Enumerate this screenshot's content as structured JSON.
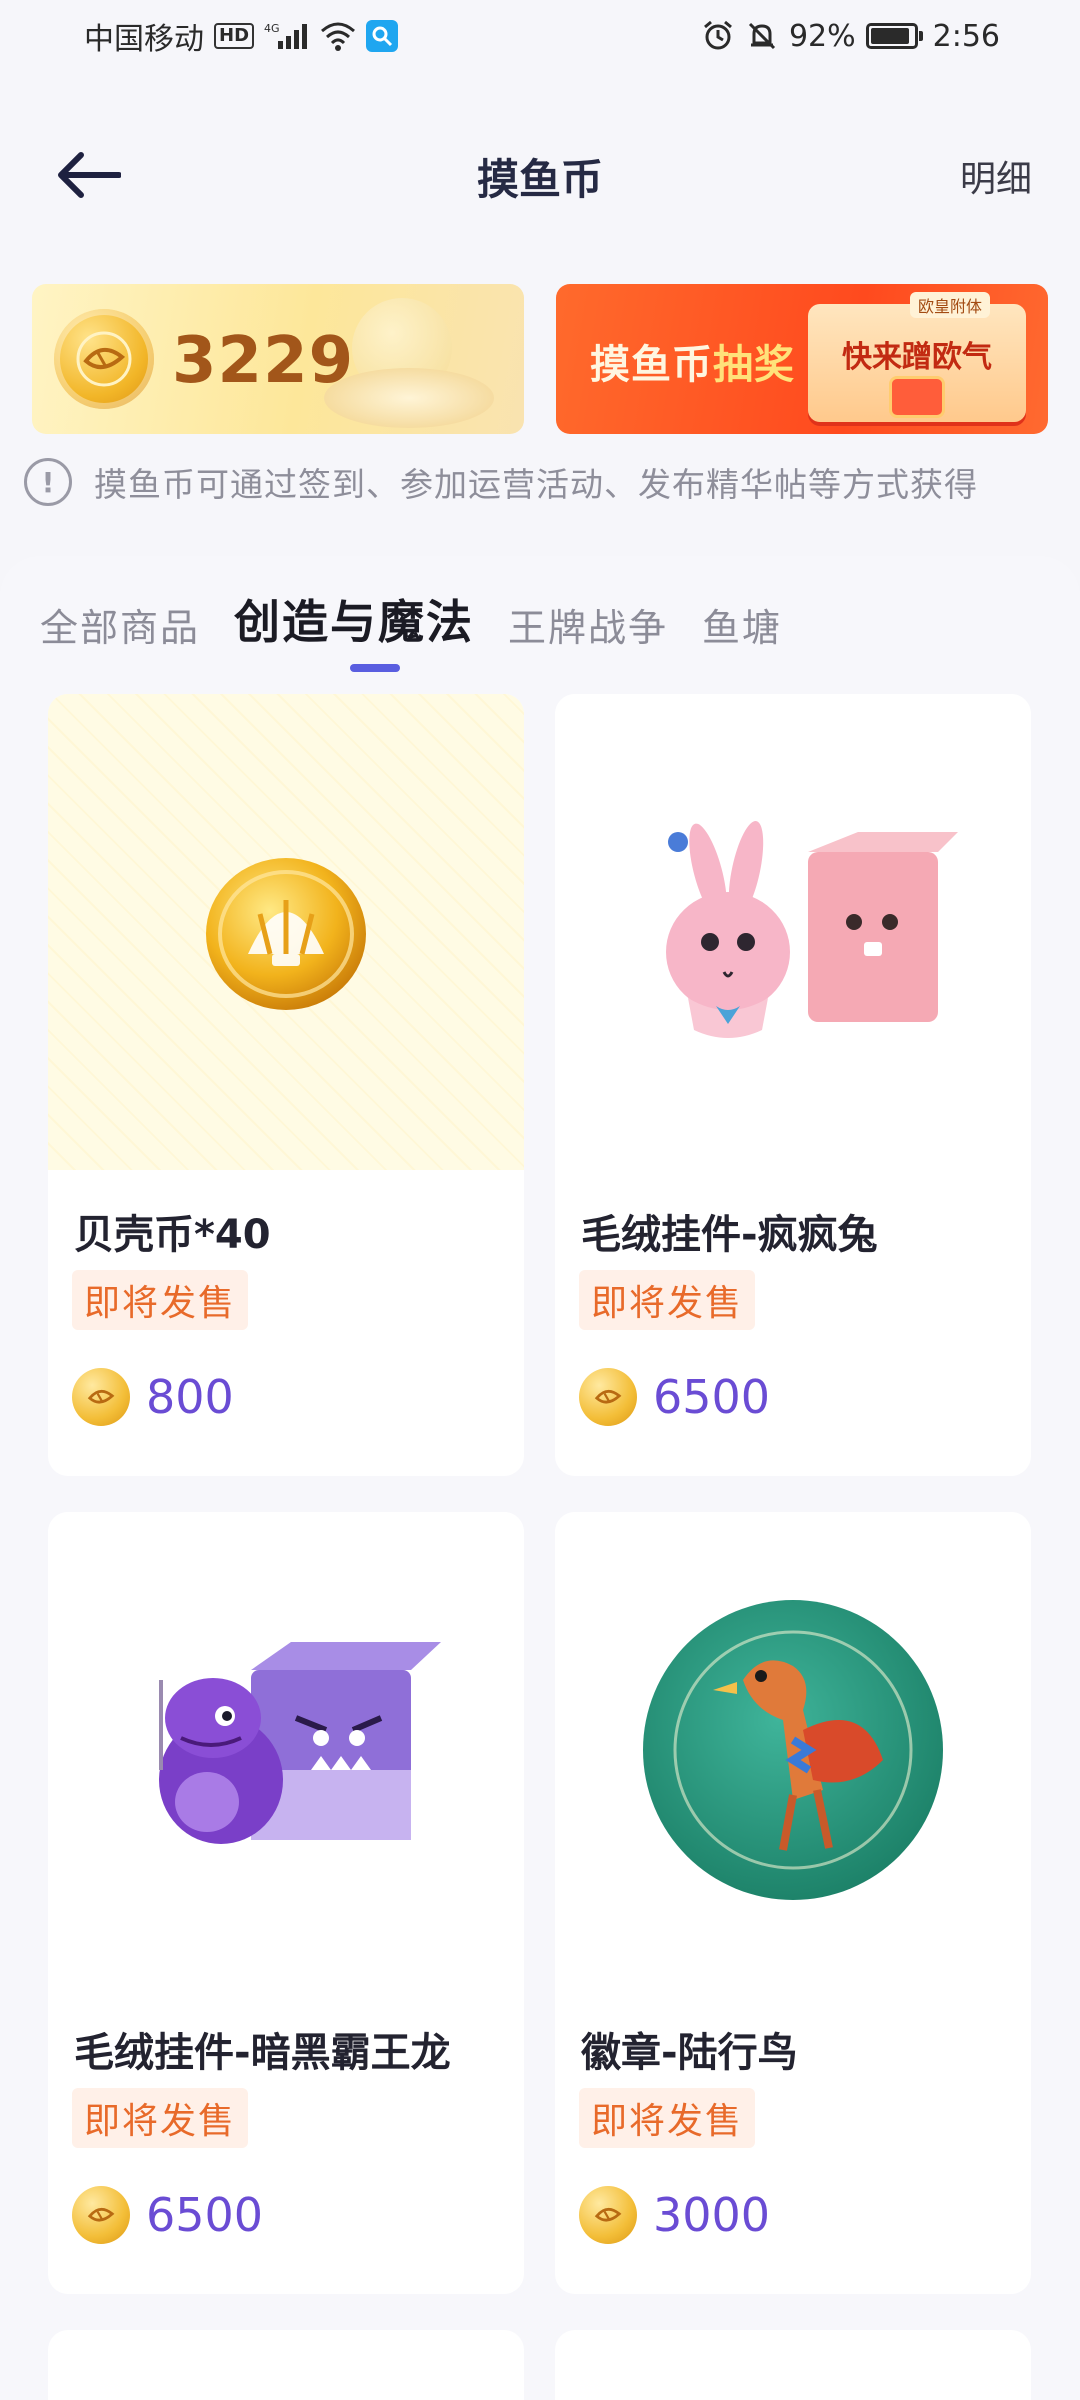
{
  "status_bar": {
    "carrier": "中国移动",
    "hd_badge": "HD",
    "network": "4G",
    "battery_percent": "92%",
    "time": "2:56"
  },
  "header": {
    "title": "摸鱼币",
    "detail_label": "明细"
  },
  "coin_banner": {
    "balance": "3229"
  },
  "lottery_banner": {
    "text_main": "摸鱼币",
    "text_highlight": "抽奖",
    "box_text": "快来蹭欧气",
    "tag": "欧皇附体"
  },
  "info": {
    "text": "摸鱼币可通过签到、参加运营活动、发布精华帖等方式获得"
  },
  "tabs": [
    {
      "label": "全部商品",
      "active": false
    },
    {
      "label": "创造与魔法",
      "active": true
    },
    {
      "label": "王牌战争",
      "active": false
    },
    {
      "label": "鱼塘",
      "active": false
    }
  ],
  "products": [
    {
      "name": "贝壳币*40",
      "status": "即将发售",
      "price": "800",
      "image": "shell-coin"
    },
    {
      "name": "毛绒挂件-疯疯兔",
      "status": "即将发售",
      "price": "6500",
      "image": "bunny-plush"
    },
    {
      "name": "毛绒挂件-暗黑霸王龙",
      "status": "即将发售",
      "price": "6500",
      "image": "dino-plush"
    },
    {
      "name": "徽章-陆行鸟",
      "status": "即将发售",
      "price": "3000",
      "image": "badge"
    }
  ],
  "colors": {
    "accent": "#5a5ee0",
    "price": "#6a4cd4",
    "presale": "#e86a2a",
    "lottery": "#ff4a1e"
  }
}
